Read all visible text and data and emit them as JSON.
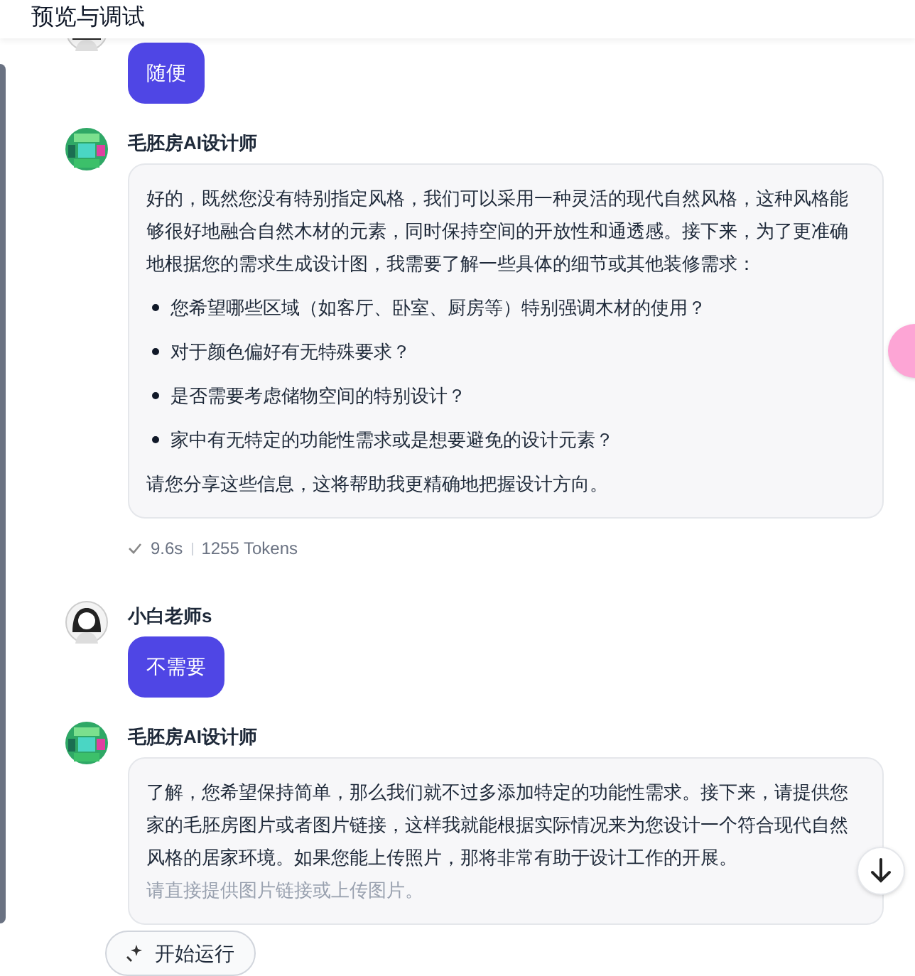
{
  "header": {
    "title": "预览与调试"
  },
  "messages": [
    {
      "kind": "user",
      "text": "随便"
    },
    {
      "kind": "ai",
      "name": "毛胚房AI设计师",
      "paragraphs": [
        "好的，既然您没有特别指定风格，我们可以采用一种灵活的现代自然风格，这种风格能够很好地融合自然木材的元素，同时保持空间的开放性和通透感。接下来，为了更准确地根据您的需求生成设计图，我需要了解一些具体的细节或其他装修需求："
      ],
      "bullets": [
        "您希望哪些区域（如客厅、卧室、厨房等）特别强调木材的使用？",
        "对于颜色偏好有无特殊要求？",
        "是否需要考虑储物空间的特别设计？",
        "家中有无特定的功能性需求或是想要避免的设计元素？"
      ],
      "closing": "请您分享这些信息，这将帮助我更精确地把握设计方向。",
      "meta": {
        "time": "9.6s",
        "tokens": "1255 Tokens"
      }
    },
    {
      "kind": "user",
      "name": "小白老师s",
      "text": "不需要"
    },
    {
      "kind": "ai",
      "name": "毛胚房AI设计师",
      "paragraphs": [
        "了解，您希望保持简单，那么我们就不过多添加特定的功能性需求。接下来，请提供您家的毛胚房图片或者图片链接，这样我就能根据实际情况来为您设计一个符合现代自然风格的居家环境。如果您能上传照片，那将非常有助于设计工作的开展。"
      ],
      "faded": "请直接提供图片链接或上传图片。"
    }
  ],
  "run_button": {
    "label": "开始运行"
  }
}
